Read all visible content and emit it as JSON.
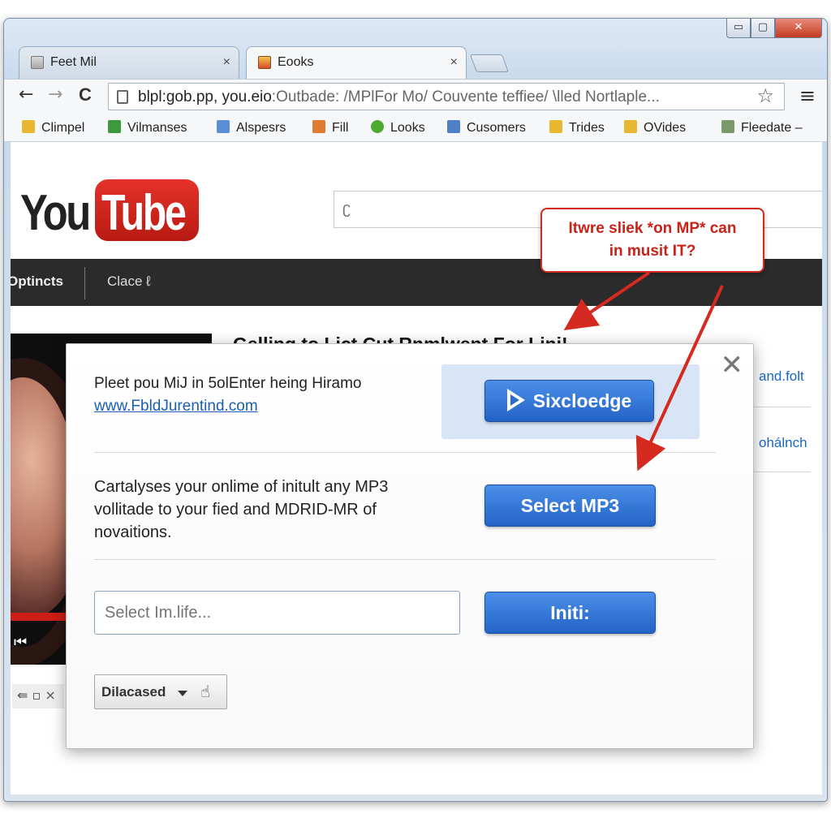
{
  "window": {
    "controls": {
      "minimize": "▭",
      "maximize": "▢",
      "close": "✕"
    }
  },
  "tabs": [
    {
      "label": "Feet Mil",
      "icon": "page-icon",
      "close": "×"
    },
    {
      "label": "Eooks",
      "icon": "bookmark-icon",
      "close": "×"
    }
  ],
  "toolbar": {
    "back": "←",
    "forward": "→",
    "reload": "C",
    "url_main": "blpl:gob.pp, you.eio",
    "url_rest": ":Outbade: /MPlFor Mo/ Couvente teffiee/ \\lled Nortlaple...",
    "star": "☆",
    "menu": "≡"
  },
  "bookmarks": [
    {
      "label": "Climpel",
      "icon": "folder-icon",
      "color": "#e8b730"
    },
    {
      "label": "Vilmanses",
      "icon": "spreadsheet-icon",
      "color": "#3c9a3c"
    },
    {
      "label": "Alspesrs",
      "icon": "document-icon",
      "color": "#5a8fd6"
    },
    {
      "label": "Fill",
      "icon": "file-icon",
      "color": "#e07a2e"
    },
    {
      "label": "Looks",
      "icon": "pin-icon",
      "color": "#4caa2f"
    },
    {
      "label": "Cusomers",
      "icon": "network-icon",
      "color": "#4f7fc4"
    },
    {
      "label": "Trides",
      "icon": "folder-icon",
      "color": "#e8b730"
    },
    {
      "label": "OVides",
      "icon": "folder-open-icon",
      "color": "#e8b730"
    },
    {
      "label": "Fleedate –",
      "icon": "image-icon",
      "color": "#7a9a6a"
    }
  ],
  "youtube": {
    "logo_you": "You",
    "logo_tube": "Tube",
    "search_caret": "ʗ",
    "nav": [
      "Optincts",
      "Clace ℓ"
    ],
    "video_title": "Gelling to Lict Cut Rnmlwent For Lini!",
    "side_links": [
      "and.folt",
      "ohálnch"
    ],
    "thumb_controls": "⇚ ▫ ×",
    "play": "⏮"
  },
  "callout": {
    "line1": "Itwre sliek *on MP* can",
    "line2": "in musit IT?"
  },
  "dialog": {
    "close": "✕",
    "text1": "Pleet pou MiJ in 5olEnter heing Hiramo",
    "link1": "www.FbldJurentind.com",
    "button1": "Sixcloedge",
    "text2_lines": [
      "Cartalyses your onlime of initult any MP3",
      "vollitade to your fied and MDRID-MR of",
      "novaitions."
    ],
    "button2": "Select MP3",
    "input_placeholder": "Select Im.life...",
    "button3": "Initi:",
    "dropdown_label": "Dilacased",
    "dropdown_icon": "☝"
  },
  "colors": {
    "accent_red": "#d42a1f",
    "button_blue": "#2b6ccd",
    "link_blue": "#1a5fb4"
  }
}
